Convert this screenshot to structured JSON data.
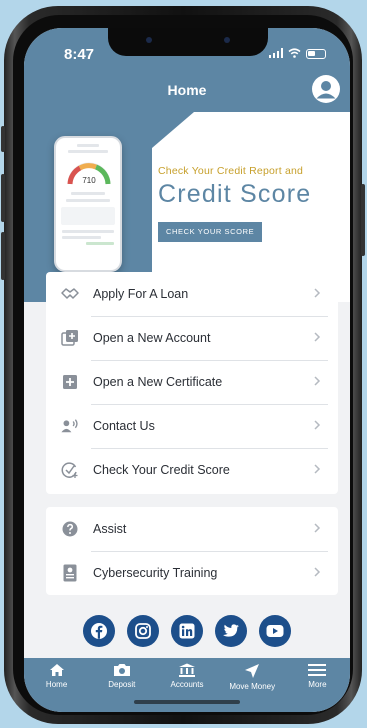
{
  "status": {
    "time": "8:47"
  },
  "header": {
    "title": "Home"
  },
  "hero": {
    "subtitle": "Check Your Credit Report and",
    "title": "Credit Score",
    "cta_label": "CHECK YOUR SCORE",
    "mock_score": "710"
  },
  "menu_primary": [
    {
      "label": "Apply For A Loan",
      "icon": "handshake-icon"
    },
    {
      "label": "Open a New Account",
      "icon": "add-box-icon"
    },
    {
      "label": "Open a New Certificate",
      "icon": "plus-square-icon"
    },
    {
      "label": "Contact Us",
      "icon": "person-speaking-icon"
    },
    {
      "label": "Check Your Credit Score",
      "icon": "check-circle-icon"
    }
  ],
  "menu_secondary": [
    {
      "label": "Assist",
      "icon": "help-circle-icon"
    },
    {
      "label": "Cybersecurity Training",
      "icon": "id-badge-icon"
    }
  ],
  "social": [
    "facebook-icon",
    "instagram-icon",
    "linkedin-icon",
    "twitter-icon",
    "youtube-icon"
  ],
  "tabs": [
    {
      "label": "Home",
      "icon": "home-icon"
    },
    {
      "label": "Deposit",
      "icon": "camera-icon"
    },
    {
      "label": "Accounts",
      "icon": "bank-icon"
    },
    {
      "label": "Move Money",
      "icon": "send-icon"
    },
    {
      "label": "More",
      "icon": "menu-icon"
    }
  ],
  "colors": {
    "brand": "#5d86a4",
    "gold": "#c7a02c",
    "social": "#1d4f8b",
    "background": "#b3d6ea"
  }
}
